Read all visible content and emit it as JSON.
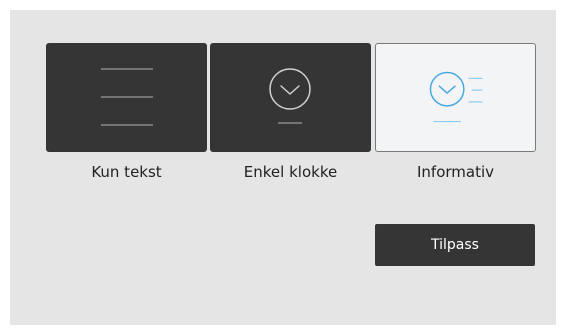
{
  "options": [
    {
      "label": "Kun tekst",
      "icon": "text-lines-icon",
      "selected": false
    },
    {
      "label": "Enkel klokke",
      "icon": "clock-icon",
      "selected": false
    },
    {
      "label": "Informativ",
      "icon": "clock-with-info-icon",
      "selected": true
    }
  ],
  "customize_label": "Tilpass",
  "colors": {
    "panel_background": "#e5e5e5",
    "tile_dark": "#353535",
    "tile_selected": "#f3f4f6",
    "accent": "#45a9e0",
    "button": "#353535",
    "button_text": "#ffffff"
  }
}
